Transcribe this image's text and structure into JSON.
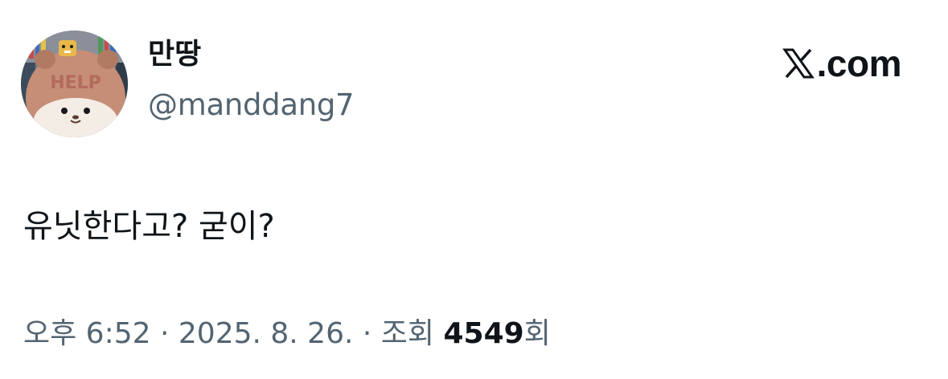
{
  "author": {
    "display_name": "만땅",
    "handle": "@manddang7",
    "avatar_text": "HELP"
  },
  "brand": {
    "icon": "x-logo-icon",
    "domain": ".com"
  },
  "tweet": {
    "text": "유닛한다고? 굳이?"
  },
  "meta": {
    "time": "오후 6:52",
    "separator": "·",
    "date": "2025. 8. 26.",
    "views_label": "조회",
    "views_count": "4549",
    "views_suffix": "회"
  },
  "colors": {
    "primary_text": "#0f1419",
    "secondary_text": "#536471",
    "background": "#ffffff"
  }
}
